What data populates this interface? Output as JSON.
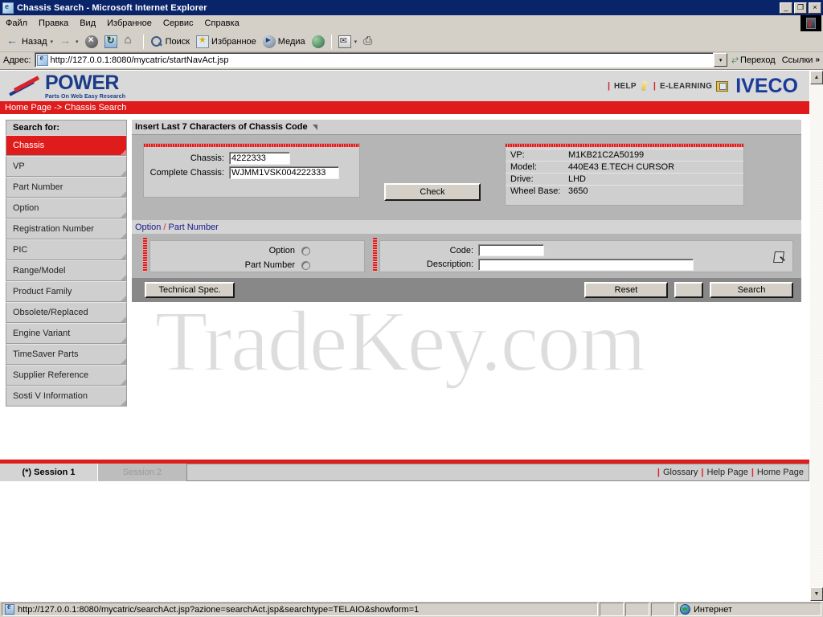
{
  "window": {
    "title": "Chassis Search - Microsoft Internet Explorer",
    "minimize": "_",
    "restore": "❐",
    "close": "×"
  },
  "menu": {
    "items": [
      "Файл",
      "Правка",
      "Вид",
      "Избранное",
      "Сервис",
      "Справка"
    ]
  },
  "toolbar": {
    "back": "Назад",
    "forward": "",
    "search": "Поиск",
    "favorites": "Избранное",
    "media": "Медиа",
    "caret": "▾"
  },
  "address": {
    "label": "Адрес:",
    "url": "http://127.0.0.1:8080/mycatric/startNavAct.jsp",
    "go": "Переход",
    "links": "Ссылки",
    "chevron": "»",
    "dropdown": "▾"
  },
  "header": {
    "logo_main": "POWER",
    "logo_sub": "Parts On Web Easy Research",
    "help": "HELP",
    "elearning": "E-LEARNING",
    "brand": "IVECO",
    "divider": "|",
    "breadcrumb": "Home Page -> Chassis Search"
  },
  "sidebar": {
    "heading": "Search for:",
    "items": [
      {
        "label": "Chassis",
        "active": true
      },
      {
        "label": "VP",
        "active": false
      },
      {
        "label": "Part Number",
        "active": false
      },
      {
        "label": "Option",
        "active": false
      },
      {
        "label": "Registration Number",
        "active": false
      },
      {
        "label": "PIC",
        "active": false
      },
      {
        "label": "Range/Model",
        "active": false
      },
      {
        "label": "Product Family",
        "active": false
      },
      {
        "label": "Obsolete/Replaced",
        "active": false
      },
      {
        "label": "Engine Variant",
        "active": false
      },
      {
        "label": "TimeSaver Parts",
        "active": false
      },
      {
        "label": "Supplier Reference",
        "active": false
      },
      {
        "label": "Sosti V Information",
        "active": false
      }
    ]
  },
  "panel": {
    "title": "Insert Last 7 Characters of Chassis Code",
    "chassis_label": "Chassis:",
    "chassis_value": "4222333",
    "complete_label": "Complete Chassis:",
    "complete_value": "WJMM1VSK004222333",
    "check_button": "Check",
    "info": [
      {
        "key": "VP:",
        "value": "M1KB21C2A50199"
      },
      {
        "key": "Model:",
        "value": "440E43 E.TECH CURSOR"
      },
      {
        "key": "Drive:",
        "value": "LHD"
      },
      {
        "key": "Wheel Base:",
        "value": "3650"
      }
    ]
  },
  "optsection": {
    "label_a": "Option",
    "slash": "/",
    "label_b": "Part Number",
    "option_radio_label": "Option",
    "partnumber_radio_label": "Part Number",
    "code_label": "Code:",
    "code_value": "",
    "description_label": "Description:",
    "description_value": ""
  },
  "actions": {
    "technical_spec": "Technical Spec.",
    "reset": "Reset",
    "blank": "",
    "search": "Search"
  },
  "session": {
    "session1": "(*) Session 1",
    "session2": "Session 2",
    "glossary": "Glossary",
    "help_page": "Help Page",
    "home_page": "Home Page",
    "bar": "|"
  },
  "statusbar": {
    "url": "http://127.0.0.1:8080/mycatric/searchAct.jsp?azione=searchAct.jsp&searchtype=TELAIO&showform=1",
    "zone": "Интернет"
  },
  "scroll": {
    "up": "▲",
    "down": "▼"
  },
  "watermark": {
    "text": "TradeKey.com"
  },
  "colors": {
    "accent_red": "#e01b1b",
    "brand_blue": "#1a3a9a",
    "title_blue": "#0a246a",
    "panel_gray": "#cfcfcf"
  }
}
